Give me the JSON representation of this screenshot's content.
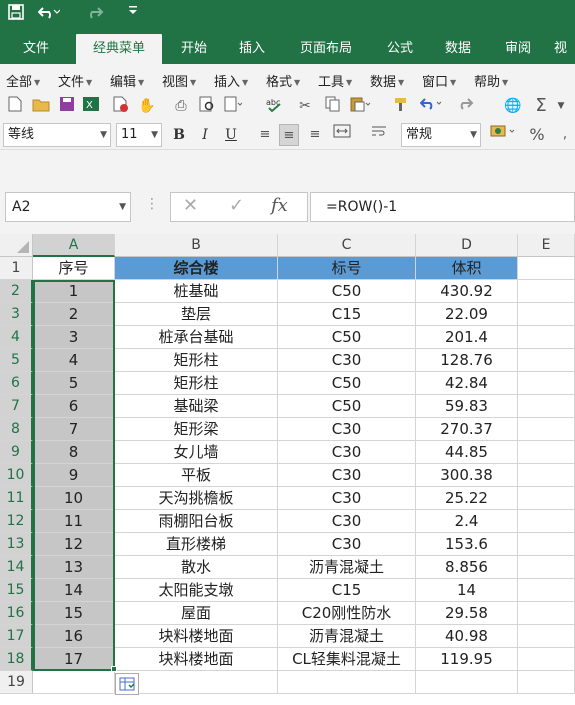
{
  "quick_access": {
    "save_icon": "save-icon",
    "undo_icon": "undo-icon",
    "redo_icon": "redo-icon"
  },
  "ribbon_tabs": [
    "文件",
    "经典菜单",
    "开始",
    "插入",
    "页面布局",
    "公式",
    "数据",
    "审阅",
    "视"
  ],
  "active_tab_index": 1,
  "menus": [
    "全部",
    "文件",
    "编辑",
    "视图",
    "插入",
    "格式",
    "工具",
    "数据",
    "窗口",
    "帮助"
  ],
  "format_bar": {
    "font_name": "等线",
    "font_size": "11",
    "bold": "B",
    "italic": "I",
    "underline": "U",
    "number_format": "常规",
    "percent": "%"
  },
  "formula_bar": {
    "name_box": "A2",
    "fx_label": "fx",
    "formula": "=ROW()-1"
  },
  "columns": [
    "A",
    "B",
    "C",
    "D",
    "E"
  ],
  "rows": [
    "1",
    "2",
    "3",
    "4",
    "5",
    "6",
    "7",
    "8",
    "9",
    "10",
    "11",
    "12",
    "13",
    "14",
    "15",
    "16",
    "17",
    "18",
    "19"
  ],
  "table": {
    "headers": [
      "序号",
      "综合楼",
      "标号",
      "体积"
    ],
    "data": [
      [
        "1",
        "桩基础",
        "C50",
        "430.92"
      ],
      [
        "2",
        "垫层",
        "C15",
        "22.09"
      ],
      [
        "3",
        "桩承台基础",
        "C50",
        "201.4"
      ],
      [
        "4",
        "矩形柱",
        "C30",
        "128.76"
      ],
      [
        "5",
        "矩形柱",
        "C50",
        "42.84"
      ],
      [
        "6",
        "基础梁",
        "C50",
        "59.83"
      ],
      [
        "7",
        "矩形梁",
        "C30",
        "270.37"
      ],
      [
        "8",
        "女儿墙",
        "C30",
        "44.85"
      ],
      [
        "9",
        "平板",
        "C30",
        "300.38"
      ],
      [
        "10",
        "天沟挑檐板",
        "C30",
        "25.22"
      ],
      [
        "11",
        "雨棚阳台板",
        "C30",
        "2.4"
      ],
      [
        "12",
        "直形楼梯",
        "C30",
        "153.6"
      ],
      [
        "13",
        "散水",
        "沥青混凝土",
        "8.856"
      ],
      [
        "14",
        "太阳能支墩",
        "C15",
        "14"
      ],
      [
        "15",
        "屋面",
        "C20刚性防水",
        "29.58"
      ],
      [
        "16",
        "块料楼地面",
        "沥青混凝土",
        "40.98"
      ],
      [
        "17",
        "块料楼地面",
        "CL轻集料混凝土",
        "119.95"
      ]
    ]
  },
  "colors": {
    "accent": "#217346",
    "header_fill": "#5b9bd5",
    "selection_fill": "#c6c6c6"
  }
}
